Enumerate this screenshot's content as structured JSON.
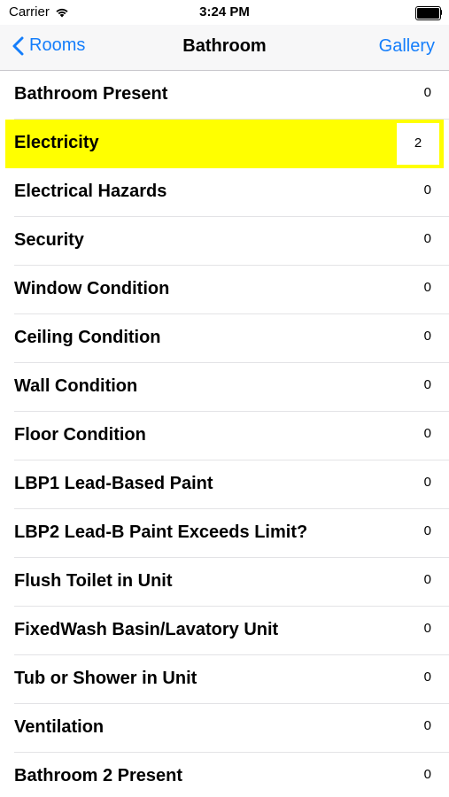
{
  "status_bar": {
    "carrier": "Carrier",
    "time": "3:24 PM",
    "wifi_icon": "wifi-icon",
    "battery_icon": "battery-icon"
  },
  "nav": {
    "back_label": "Rooms",
    "title": "Bathroom",
    "right_label": "Gallery",
    "accent_color": "#157efb"
  },
  "highlight_color": "#ffff00",
  "list": {
    "items": [
      {
        "label": "Bathroom Present",
        "value": "0"
      },
      {
        "label": "Electricity",
        "value": "2",
        "highlighted": true
      },
      {
        "label": "Electrical Hazards",
        "value": "0"
      },
      {
        "label": "Security",
        "value": "0"
      },
      {
        "label": "Window Condition",
        "value": "0"
      },
      {
        "label": "Ceiling Condition",
        "value": "0"
      },
      {
        "label": "Wall Condition",
        "value": "0"
      },
      {
        "label": "Floor Condition",
        "value": "0"
      },
      {
        "label": "LBP1 Lead-Based Paint",
        "value": "0"
      },
      {
        "label": "LBP2 Lead-B Paint Exceeds Limit?",
        "value": "0"
      },
      {
        "label": "Flush Toilet in Unit",
        "value": "0"
      },
      {
        "label": "FixedWash Basin/Lavatory Unit",
        "value": "0"
      },
      {
        "label": "Tub or Shower in Unit",
        "value": "0"
      },
      {
        "label": "Ventilation",
        "value": "0"
      },
      {
        "label": "Bathroom 2 Present",
        "value": "0"
      }
    ]
  }
}
